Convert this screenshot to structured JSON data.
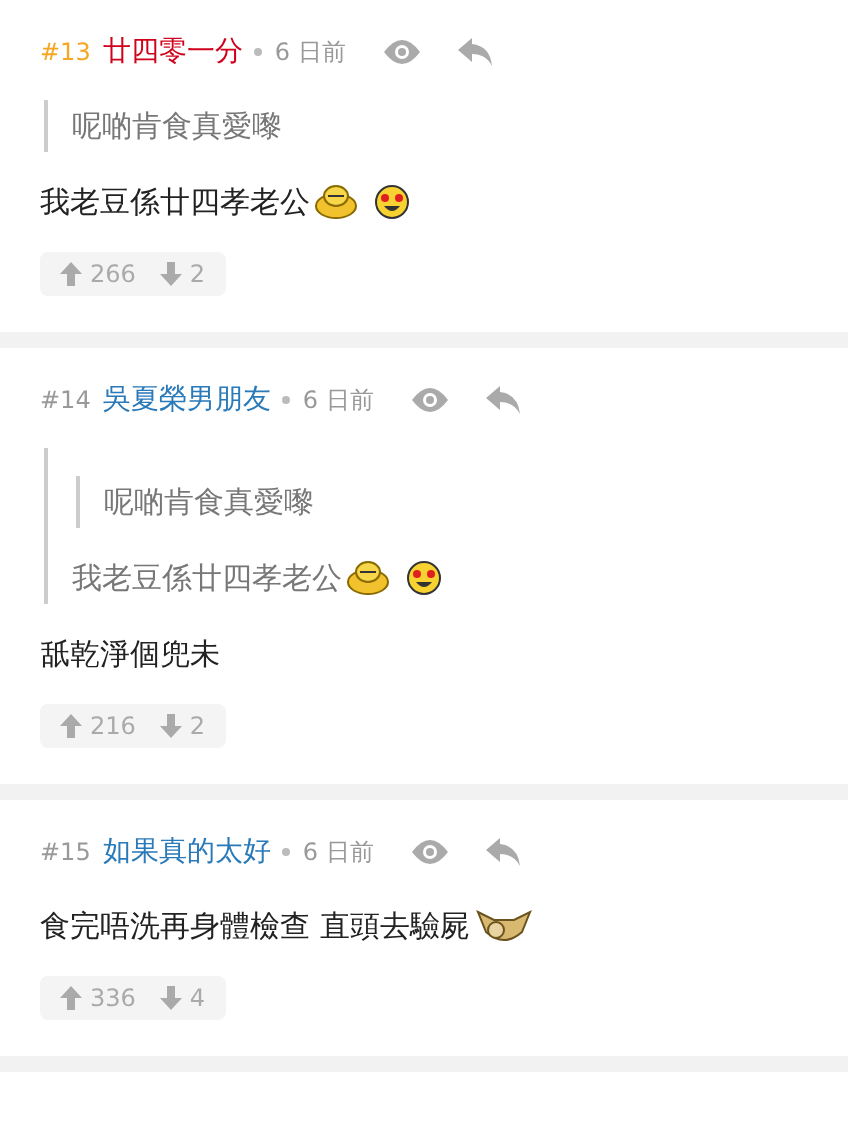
{
  "posts": [
    {
      "number": "#13",
      "highlighted": true,
      "author": "廿四零一分",
      "color": "#d0021b",
      "time": "6 日前",
      "quote": {
        "lines": [
          [
            {
              "kind": "text",
              "text": "呢啲肯食真愛嚟"
            }
          ]
        ]
      },
      "body": [
        {
          "kind": "text",
          "text": "我老豆係廿四孝老公"
        },
        {
          "kind": "shy"
        },
        {
          "kind": "hearteyes"
        }
      ],
      "upvotes": "266",
      "downvotes": "2"
    },
    {
      "number": "#14",
      "highlighted": false,
      "author": "吳夏榮男朋友",
      "color": "#2a7ab9",
      "time": "6 日前",
      "quote": {
        "quote": {
          "lines": [
            [
              {
                "kind": "text",
                "text": "呢啲肯食真愛嚟"
              }
            ]
          ]
        },
        "lines": [
          [
            {
              "kind": "text",
              "text": "我老豆係廿四孝老公"
            },
            {
              "kind": "shy"
            },
            {
              "kind": "hearteyes"
            }
          ]
        ]
      },
      "body": [
        {
          "kind": "text",
          "text": "舐乾淨個兜未"
        }
      ],
      "upvotes": "216",
      "downvotes": "2"
    },
    {
      "number": "#15",
      "highlighted": false,
      "author": "如果真的太好",
      "color": "#2a7ab9",
      "time": "6 日前",
      "body": [
        {
          "kind": "text",
          "text": "食完唔洗再身體檢查 直頭去驗屍"
        },
        {
          "kind": "facepalm"
        }
      ],
      "upvotes": "336",
      "downvotes": "4"
    }
  ]
}
